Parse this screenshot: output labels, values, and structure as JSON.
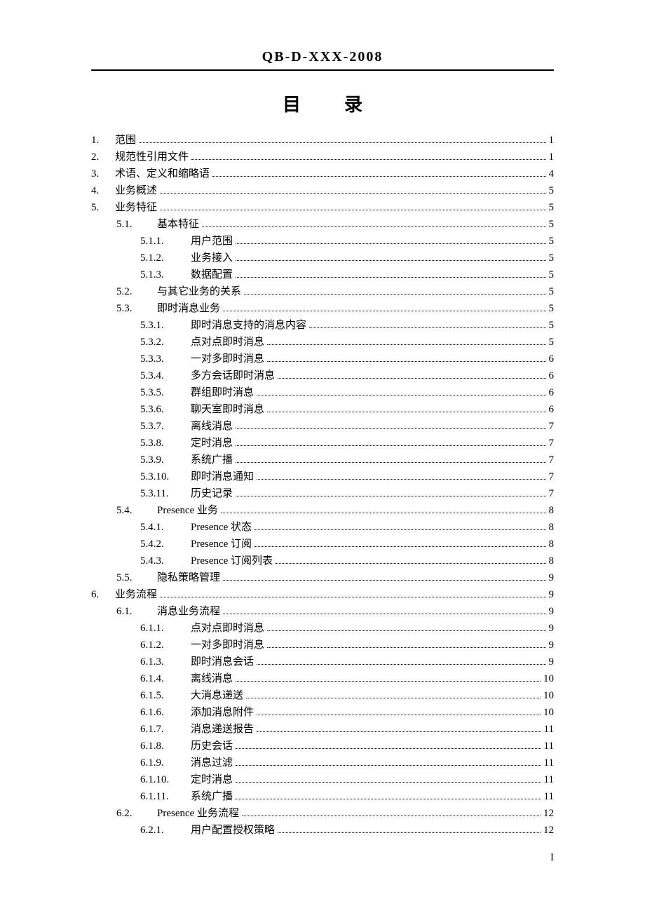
{
  "header": "QB-D-XXX-2008",
  "toc_title": "目录",
  "page_number": "I",
  "toc": [
    {
      "level": 1,
      "num": "1.",
      "label": "范围",
      "page": "1"
    },
    {
      "level": 1,
      "num": "2.",
      "label": "规范性引用文件",
      "page": "1"
    },
    {
      "level": 1,
      "num": "3.",
      "label": "术语、定义和缩略语",
      "page": "4"
    },
    {
      "level": 1,
      "num": "4.",
      "label": "业务概述",
      "page": "5"
    },
    {
      "level": 1,
      "num": "5.",
      "label": "业务特征",
      "page": "5"
    },
    {
      "level": 2,
      "num": "5.1.",
      "label": "基本特征",
      "page": "5"
    },
    {
      "level": 3,
      "num": "5.1.1.",
      "label": "用户范围",
      "page": "5"
    },
    {
      "level": 3,
      "num": "5.1.2.",
      "label": "业务接入",
      "page": "5"
    },
    {
      "level": 3,
      "num": "5.1.3.",
      "label": "数据配置",
      "page": "5"
    },
    {
      "level": 2,
      "num": "5.2.",
      "label": "与其它业务的关系",
      "page": "5"
    },
    {
      "level": 2,
      "num": "5.3.",
      "label": "即时消息业务",
      "page": "5"
    },
    {
      "level": 3,
      "num": "5.3.1.",
      "label": "即时消息支持的消息内容",
      "page": "5"
    },
    {
      "level": 3,
      "num": "5.3.2.",
      "label": "点对点即时消息",
      "page": "5"
    },
    {
      "level": 3,
      "num": "5.3.3.",
      "label": "一对多即时消息",
      "page": "6"
    },
    {
      "level": 3,
      "num": "5.3.4.",
      "label": "多方会话即时消息",
      "page": "6"
    },
    {
      "level": 3,
      "num": "5.3.5.",
      "label": "群组即时消息",
      "page": "6"
    },
    {
      "level": 3,
      "num": "5.3.6.",
      "label": "聊天室即时消息",
      "page": "6"
    },
    {
      "level": 3,
      "num": "5.3.7.",
      "label": "离线消息",
      "page": "7"
    },
    {
      "level": 3,
      "num": "5.3.8.",
      "label": "定时消息",
      "page": "7"
    },
    {
      "level": 3,
      "num": "5.3.9.",
      "label": "系统广播",
      "page": "7"
    },
    {
      "level": 3,
      "num": "5.3.10.",
      "label": "即时消息通知",
      "page": "7"
    },
    {
      "level": 3,
      "num": "5.3.11.",
      "label": "历史记录",
      "page": "7"
    },
    {
      "level": 2,
      "num": "5.4.",
      "label": "Presence 业务",
      "page": "8"
    },
    {
      "level": 3,
      "num": "5.4.1.",
      "label": "Presence 状态",
      "page": "8"
    },
    {
      "level": 3,
      "num": "5.4.2.",
      "label": "Presence 订阅",
      "page": "8"
    },
    {
      "level": 3,
      "num": "5.4.3.",
      "label": "Presence 订阅列表",
      "page": "8"
    },
    {
      "level": 2,
      "num": "5.5.",
      "label": "隐私策略管理",
      "page": "9"
    },
    {
      "level": 1,
      "num": "6.",
      "label": "业务流程",
      "page": "9"
    },
    {
      "level": 2,
      "num": "6.1.",
      "label": "消息业务流程",
      "page": "9"
    },
    {
      "level": 3,
      "num": "6.1.1.",
      "label": "点对点即时消息",
      "page": "9"
    },
    {
      "level": 3,
      "num": "6.1.2.",
      "label": "一对多即时消息",
      "page": "9"
    },
    {
      "level": 3,
      "num": "6.1.3.",
      "label": "即时消息会话",
      "page": "9"
    },
    {
      "level": 3,
      "num": "6.1.4.",
      "label": "离线消息",
      "page": "10"
    },
    {
      "level": 3,
      "num": "6.1.5.",
      "label": "大消息递送",
      "page": "10"
    },
    {
      "level": 3,
      "num": "6.1.6.",
      "label": "添加消息附件",
      "page": "10"
    },
    {
      "level": 3,
      "num": "6.1.7.",
      "label": "消息递送报告",
      "page": "11"
    },
    {
      "level": 3,
      "num": "6.1.8.",
      "label": "历史会话",
      "page": "11"
    },
    {
      "level": 3,
      "num": "6.1.9.",
      "label": "消息过滤",
      "page": "11"
    },
    {
      "level": 3,
      "num": "6.1.10.",
      "label": "定时消息",
      "page": "11"
    },
    {
      "level": 3,
      "num": "6.1.11.",
      "label": "系统广播",
      "page": "11"
    },
    {
      "level": 2,
      "num": "6.2.",
      "label": "Presence 业务流程",
      "page": "12"
    },
    {
      "level": 3,
      "num": "6.2.1.",
      "label": "用户配置授权策略",
      "page": "12"
    }
  ]
}
